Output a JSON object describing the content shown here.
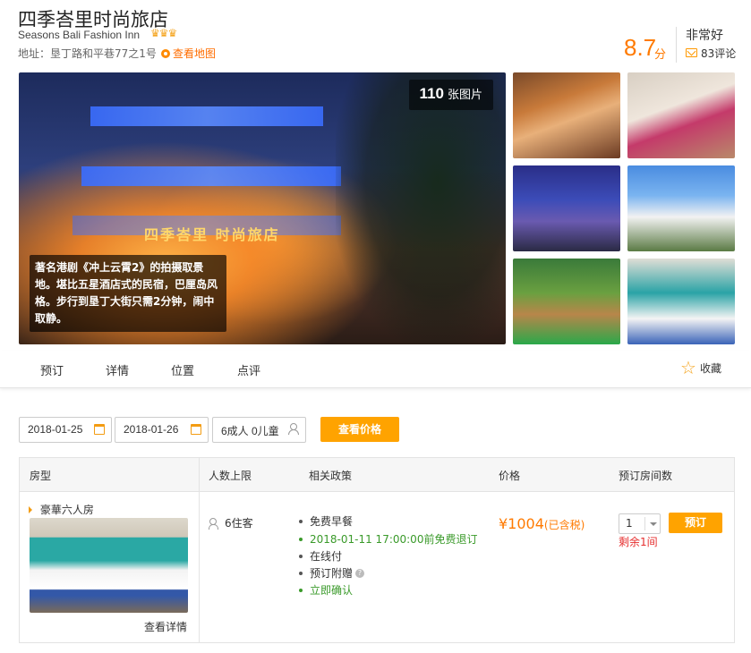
{
  "hotel": {
    "name_cn": "四季峇里时尚旅店",
    "name_en": "Seasons Bali Fashion Inn",
    "stars": "♛♛♛",
    "address": "地址：垦丁路和平巷77之1号",
    "map_link": "查看地图",
    "score": "8.7",
    "score_unit": "分",
    "rating_text": "非常好",
    "reviews": "83评论"
  },
  "gallery": {
    "photo_count": "110",
    "photo_count_label": "张图片",
    "sign_text": "四季峇里 时尚旅店",
    "caption": "著名港剧《冲上云霄2》的拍摄取景地。堪比五星酒店式的民宿，巴厘岛风格。步行到垦丁大街只需2分钟，闹中取静。"
  },
  "tabs": [
    "预订",
    "详情",
    "位置",
    "点评"
  ],
  "favorite": "收藏",
  "search": {
    "checkin": "2018-01-25",
    "checkout": "2018-01-26",
    "guests": "6成人 0儿童",
    "button": "查看价格"
  },
  "table": {
    "headers": [
      "房型",
      "人数上限",
      "相关政策",
      "价格",
      "预订房间数"
    ],
    "room": {
      "name": "豪華六人房",
      "detail_link": "查看详情",
      "capacity": "6住客",
      "policies": [
        "免费早餐",
        "2018-01-11 17:00:00前免费退订",
        "在线付",
        "预订附赠",
        "立即确认"
      ],
      "price": "¥1004",
      "tax_note": "(已含税)",
      "quantity": "1",
      "book_button": "预订",
      "remaining": "剩余1间"
    }
  },
  "colors": {
    "accent": "#ffa300",
    "score": "#ff7a00",
    "policy_green": "#3a9a2a",
    "warning_red": "#e62e2e"
  }
}
